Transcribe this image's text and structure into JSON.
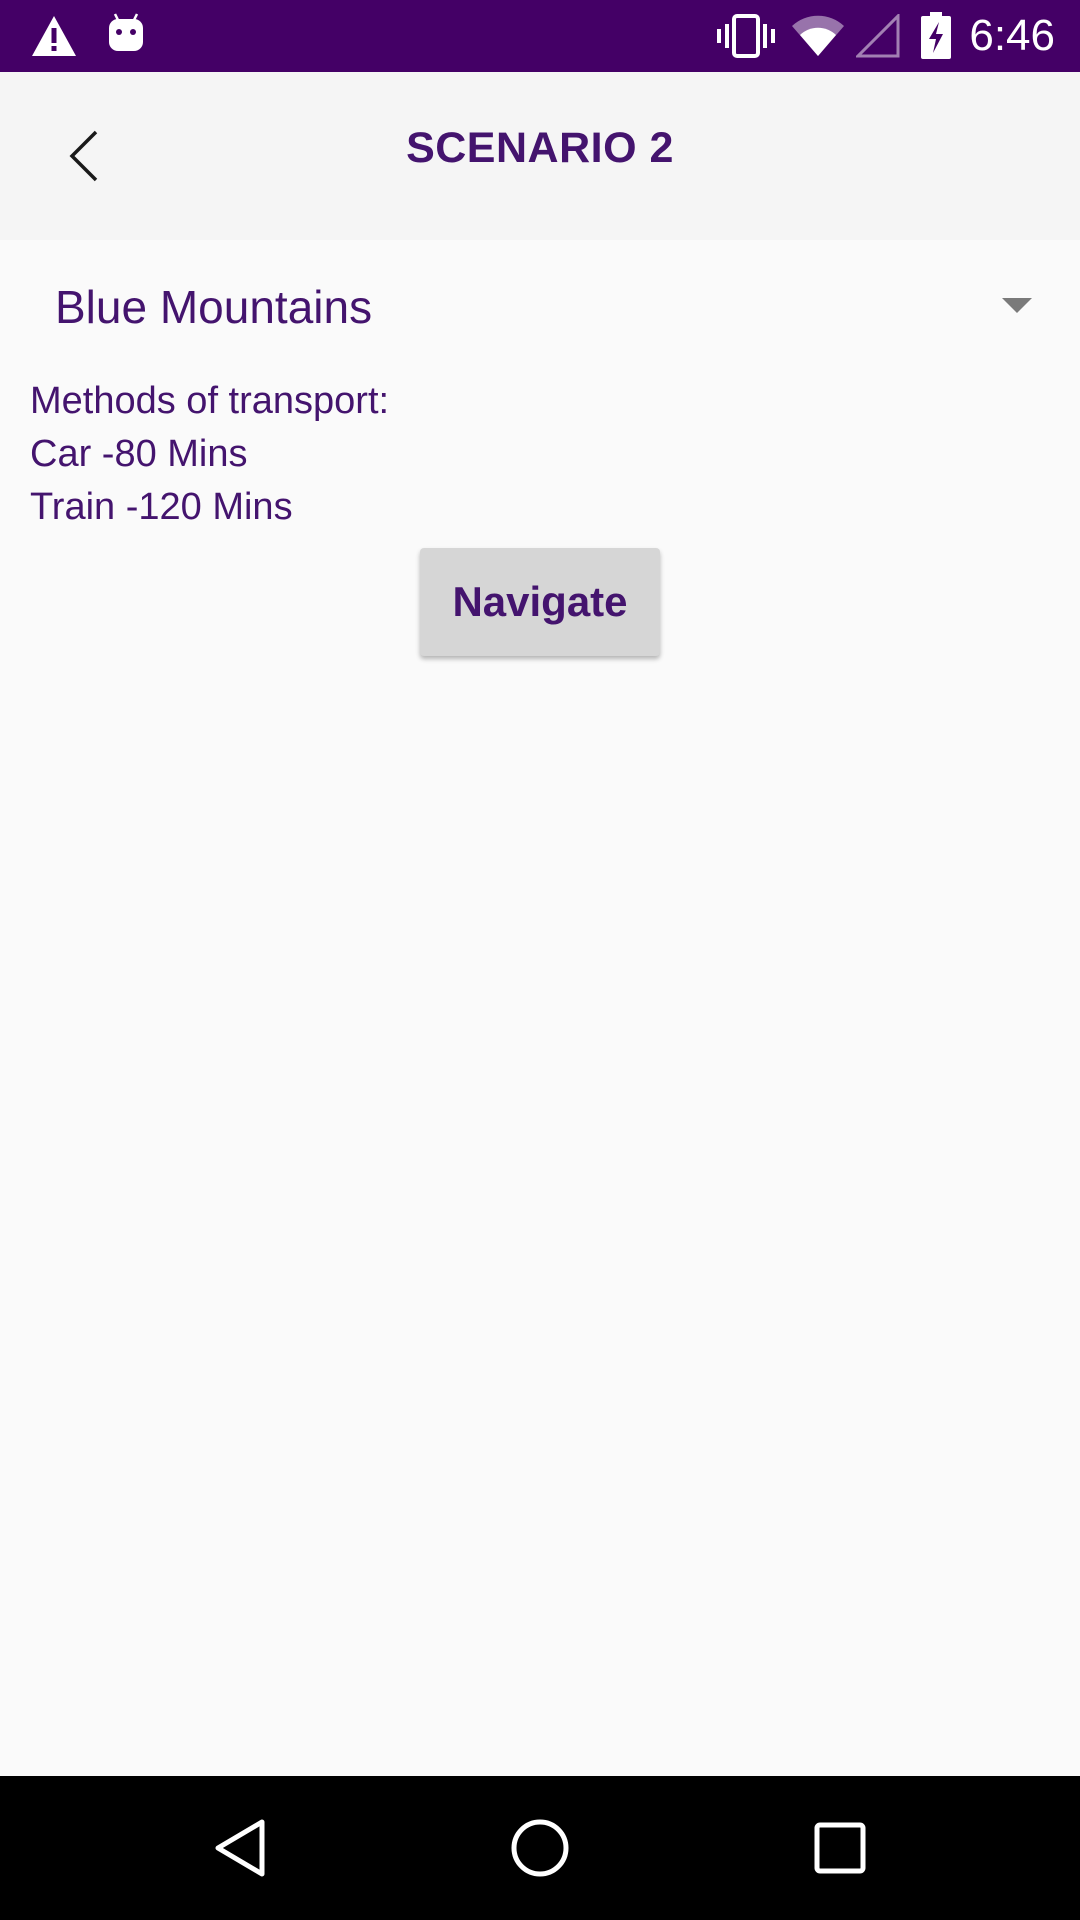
{
  "status_bar": {
    "time": "6:46",
    "background": "#440066",
    "icons": [
      "warning-icon",
      "android-icon",
      "vibrate-icon",
      "wifi-icon",
      "signal-icon",
      "battery-charging-icon"
    ]
  },
  "app_bar": {
    "title": "SCENARIO 2",
    "back_icon": "chevron-left-icon"
  },
  "destination_spinner": {
    "selected": "Blue Mountains",
    "icon": "dropdown-arrow-icon"
  },
  "transport_info": {
    "heading": "Methods of transport:",
    "lines": [
      "Car -80 Mins",
      "Train -120 Mins"
    ]
  },
  "navigate_button": {
    "label": "Navigate"
  },
  "nav_bar": {
    "icons": [
      "back-triangle-icon",
      "home-circle-icon",
      "recents-square-icon"
    ]
  },
  "colors": {
    "accent_text": "#44146e",
    "page_background": "#fafafa",
    "app_bar_background": "#f5f5f5",
    "button_background": "#d6d6d6"
  }
}
